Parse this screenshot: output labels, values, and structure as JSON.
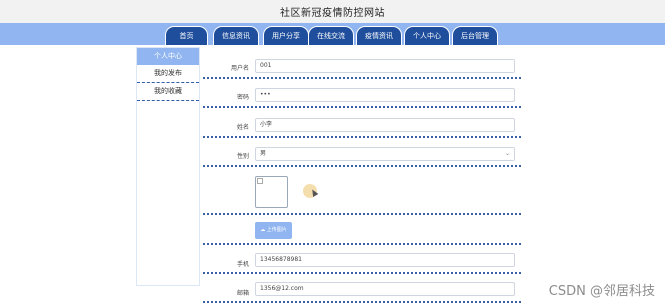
{
  "header": {
    "title": "社区新冠疫情防控网站"
  },
  "nav": {
    "tabs": [
      {
        "label": "首页"
      },
      {
        "label": "信息资讯"
      },
      {
        "label": "用户分享"
      },
      {
        "label": "在线交流"
      },
      {
        "label": "疫情资讯"
      },
      {
        "label": "个人中心"
      },
      {
        "label": "后台管理"
      }
    ]
  },
  "sidebar": {
    "items": [
      {
        "label": "个人中心",
        "active": true
      },
      {
        "label": "我的发布",
        "active": false
      },
      {
        "label": "我的收藏",
        "active": false
      }
    ]
  },
  "form": {
    "username": {
      "label": "用户名",
      "value": "001"
    },
    "password": {
      "label": "密码",
      "value": "•••"
    },
    "name": {
      "label": "姓名",
      "value": "小李"
    },
    "gender": {
      "label": "性别",
      "value": "男"
    },
    "upload_label": "上传图片",
    "phone": {
      "label": "手机",
      "value": "13456878981"
    },
    "email": {
      "label": "邮箱",
      "value": "1356@12.com"
    }
  },
  "colors": {
    "nav_bg": "#90b5f0",
    "tab_bg": "#1f4f9c",
    "divider": "#3a5fa8"
  },
  "watermark": "CSDN @邻居科技"
}
